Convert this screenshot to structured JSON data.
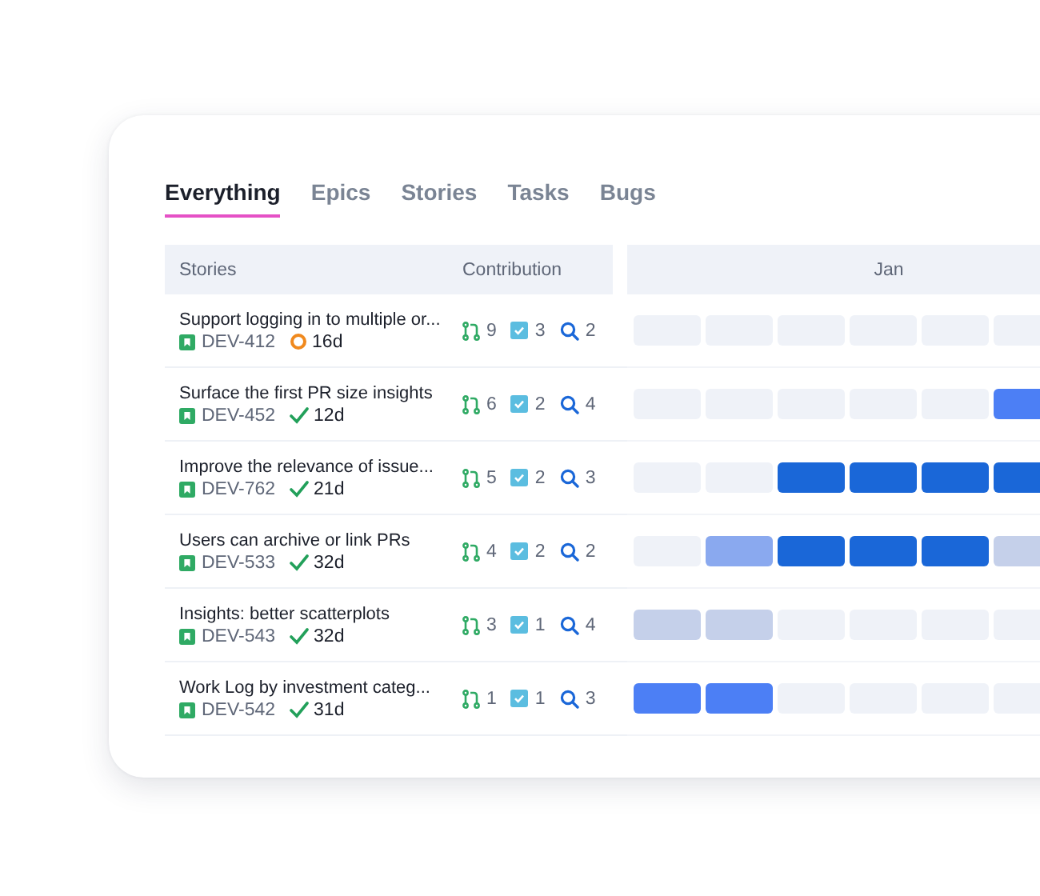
{
  "tabs": [
    {
      "label": "Everything",
      "selected": true
    },
    {
      "label": "Epics",
      "selected": false
    },
    {
      "label": "Stories",
      "selected": false
    },
    {
      "label": "Tasks",
      "selected": false
    },
    {
      "label": "Bugs",
      "selected": false
    }
  ],
  "table": {
    "columns": [
      "Stories",
      "Contribution",
      "Jan"
    ],
    "rows": [
      {
        "title": "Support logging in to multiple or...",
        "id": "DEV-412",
        "kind": "in_progress",
        "age": "16d",
        "prs": "9",
        "tasks": "3",
        "reviews": "2",
        "cells": [
          {
            "color": "#eff2f8"
          },
          {
            "color": "#eff2f8"
          },
          {
            "color": "#eff2f8"
          },
          {
            "color": "#eff2f8"
          },
          {
            "color": "#eff2f8"
          },
          {
            "color": "#eff2f8"
          }
        ]
      },
      {
        "title": "Surface the first PR size insights",
        "id": "DEV-452",
        "kind": "done",
        "age": "12d",
        "prs": "6",
        "tasks": "2",
        "reviews": "4",
        "cells": [
          {
            "color": "#eff2f8"
          },
          {
            "color": "#eff2f8"
          },
          {
            "color": "#eff2f8"
          },
          {
            "color": "#eff2f8"
          },
          {
            "color": "#eff2f8"
          },
          {
            "color": "#4c7ff5"
          }
        ]
      },
      {
        "title": "Improve the relevance of issue...",
        "id": "DEV-762",
        "kind": "done",
        "age": "21d",
        "prs": "5",
        "tasks": "2",
        "reviews": "3",
        "cells": [
          {
            "color": "#eff2f8"
          },
          {
            "color": "#eff2f8"
          },
          {
            "color": "#1a67d8"
          },
          {
            "color": "#1a67d8"
          },
          {
            "color": "#1a67d8"
          },
          {
            "color": "#1a67d8"
          }
        ]
      },
      {
        "title": "Users can archive or link PRs",
        "id": "DEV-533",
        "kind": "done",
        "age": "32d",
        "prs": "4",
        "tasks": "2",
        "reviews": "2",
        "cells": [
          {
            "color": "#eff2f8"
          },
          {
            "color": "#8aa9ef"
          },
          {
            "color": "#1a67d8"
          },
          {
            "color": "#1a67d8"
          },
          {
            "color": "#1a67d8"
          },
          {
            "color": "#c5d0ea"
          }
        ]
      },
      {
        "title": "Insights: better scatterplots",
        "id": "DEV-543",
        "kind": "done",
        "age": "32d",
        "prs": "3",
        "tasks": "1",
        "reviews": "4",
        "cells": [
          {
            "color": "#c5d0ea"
          },
          {
            "color": "#c5d0ea"
          },
          {
            "color": "#eff2f8"
          },
          {
            "color": "#eff2f8"
          },
          {
            "color": "#eff2f8"
          },
          {
            "color": "#eff2f8"
          }
        ]
      },
      {
        "title": "Work Log by investment categ...",
        "id": "DEV-542",
        "kind": "done",
        "age": "31d",
        "prs": "1",
        "tasks": "1",
        "reviews": "3",
        "cells": [
          {
            "color": "#4c7ff5"
          },
          {
            "color": "#4c7ff5"
          },
          {
            "color": "#eff2f8"
          },
          {
            "color": "#eff2f8"
          },
          {
            "color": "#eff2f8"
          },
          {
            "color": "#eff2f8"
          }
        ]
      }
    ]
  }
}
